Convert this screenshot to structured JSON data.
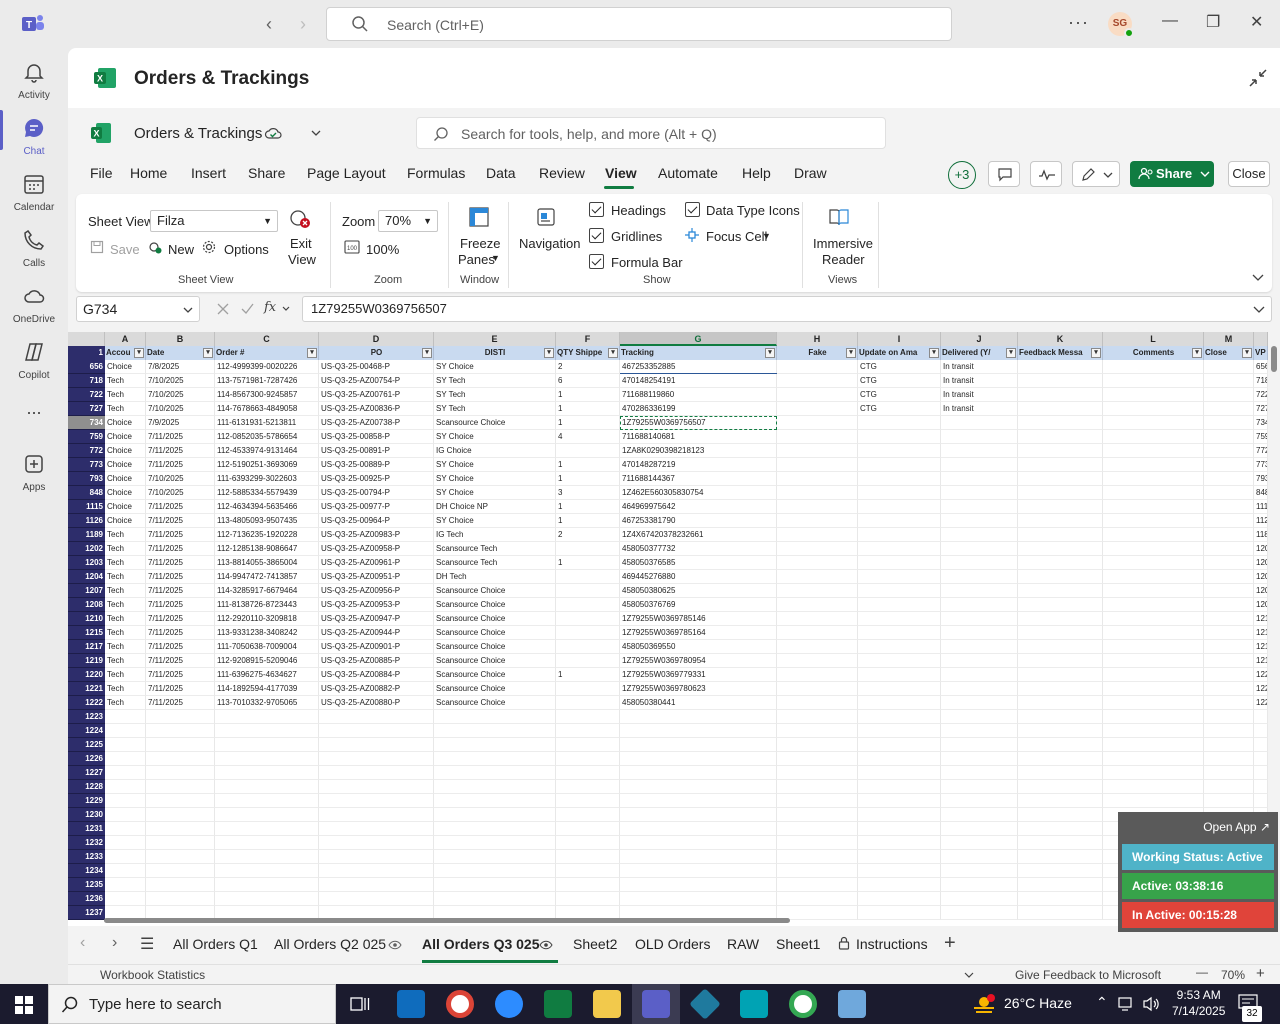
{
  "teams": {
    "search_placeholder": "Search (Ctrl+E)",
    "avatar_initials": "SG",
    "rail": [
      {
        "label": "Activity",
        "icon": "bell-icon"
      },
      {
        "label": "Chat",
        "icon": "chat-icon",
        "active": true
      },
      {
        "label": "Calendar",
        "icon": "calendar-icon"
      },
      {
        "label": "Calls",
        "icon": "phone-icon"
      },
      {
        "label": "OneDrive",
        "icon": "cloud-icon"
      },
      {
        "label": "Copilot",
        "icon": "copilot-icon"
      },
      {
        "label": "...",
        "icon": "more-icon"
      },
      {
        "label": "Apps",
        "icon": "apps-icon"
      }
    ],
    "app_title": "Orders & Trackings"
  },
  "excel": {
    "workbook_name": "Orders & Trackings",
    "tools_search_placeholder": "Search for tools, help, and more (Alt + Q)",
    "menu": [
      "File",
      "Home",
      "Insert",
      "Share",
      "Page Layout",
      "Formulas",
      "Data",
      "Review",
      "View",
      "Automate",
      "Help",
      "Draw"
    ],
    "active_menu": "View",
    "collab_count": "+3",
    "share_label": "Share",
    "close_label": "Close",
    "ribbon": {
      "sheet_view_label": "Sheet View",
      "sheet_view_value": "Filza",
      "save_label": "Save",
      "new_label": "New",
      "options_label": "Options",
      "exit_view_label_1": "Exit",
      "exit_view_label_2": "View",
      "group_sheet_view": "Sheet View",
      "zoom_label": "Zoom",
      "zoom_value": "70%",
      "zoom_100_label": "100%",
      "group_zoom": "Zoom",
      "freeze_label_1": "Freeze",
      "freeze_label_2": "Panes",
      "group_window": "Window",
      "navigation_label": "Navigation",
      "headings_label": "Headings",
      "gridlines_label": "Gridlines",
      "formula_bar_label": "Formula Bar",
      "data_type_icons_label": "Data Type Icons",
      "focus_cell_label": "Focus Cell",
      "group_show": "Show",
      "immersive_label_1": "Immersive",
      "immersive_label_2": "Reader",
      "group_views": "Views"
    },
    "name_box": "G734",
    "formula_value": "1Z79255W0369756507",
    "columns": [
      "A",
      "B",
      "C",
      "D",
      "E",
      "F",
      "G",
      "H",
      "I",
      "J",
      "K",
      "L",
      "M",
      ""
    ],
    "headers": [
      "Accou",
      "Date",
      "Order #",
      "PO",
      "DISTI",
      "QTY Shippe",
      "Tracking",
      "Fake",
      "Update on Ama",
      "Delivered (Y/",
      "Feedback Messa",
      "Comments",
      "Close",
      "VP"
    ],
    "row_numbers_top": "1",
    "rows": [
      {
        "n": "656",
        "a": "Choice",
        "b": "7/8/2025",
        "c": "112-4999399-0020226",
        "d": "US-Q3-25-00468-P",
        "e": "SY Choice",
        "f": "2",
        "g": "467253352885",
        "i": "CTG",
        "j": "In transit"
      },
      {
        "n": "718",
        "a": "Tech",
        "b": "7/10/2025",
        "c": "113-7571981-7287426",
        "d": "US-Q3-25-AZ00754-P",
        "e": "SY Tech",
        "f": "6",
        "g": "470148254191",
        "i": "CTG",
        "j": "In transit"
      },
      {
        "n": "722",
        "a": "Tech",
        "b": "7/10/2025",
        "c": "114-8567300-9245857",
        "d": "US-Q3-25-AZ00761-P",
        "e": "SY Tech",
        "f": "1",
        "g": "711688119860",
        "i": "CTG",
        "j": "In transit"
      },
      {
        "n": "727",
        "a": "Tech",
        "b": "7/10/2025",
        "c": "114-7678663-4849058",
        "d": "US-Q3-25-AZ00836-P",
        "e": "SY Tech",
        "f": "1",
        "g": "470286336199",
        "i": "CTG",
        "j": "In transit"
      },
      {
        "n": "734",
        "a": "Choice",
        "b": "7/9/2025",
        "c": "111-6131931-5213811",
        "d": "US-Q3-25-AZ00738-P",
        "e": "Scansource Choice",
        "f": "1",
        "g": "1Z79255W0369756507",
        "i": "",
        "j": ""
      },
      {
        "n": "759",
        "a": "Choice",
        "b": "7/11/2025",
        "c": "112-0852035-5786654",
        "d": "US-Q3-25-00858-P",
        "e": "SY Choice",
        "f": "4",
        "g": "711688140681",
        "i": "",
        "j": ""
      },
      {
        "n": "772",
        "a": "Choice",
        "b": "7/11/2025",
        "c": "112-4533974-9131464",
        "d": "US-Q3-25-00891-P",
        "e": "IG Choice",
        "f": "",
        "g": "1ZA8K0290398218123",
        "i": "",
        "j": ""
      },
      {
        "n": "773",
        "a": "Choice",
        "b": "7/11/2025",
        "c": "112-5190251-3693069",
        "d": "US-Q3-25-00889-P",
        "e": "SY Choice",
        "f": "1",
        "g": "470148287219",
        "i": "",
        "j": ""
      },
      {
        "n": "793",
        "a": "Choice",
        "b": "7/10/2025",
        "c": "111-6393299-3022603",
        "d": "US-Q3-25-00925-P",
        "e": "SY Choice",
        "f": "1",
        "g": "711688144367",
        "i": "",
        "j": ""
      },
      {
        "n": "848",
        "a": "Choice",
        "b": "7/10/2025",
        "c": "112-5885334-5579439",
        "d": "US-Q3-25-00794-P",
        "e": "SY Choice",
        "f": "3",
        "g": "1Z462E560305830754",
        "i": "",
        "j": ""
      },
      {
        "n": "1115",
        "a": "Choice",
        "b": "7/11/2025",
        "c": "112-4634394-5635466",
        "d": "US-Q3-25-00977-P",
        "e": "DH Choice NP",
        "f": "1",
        "g": "464969975642",
        "i": "",
        "j": ""
      },
      {
        "n": "1126",
        "a": "Choice",
        "b": "7/11/2025",
        "c": "113-4805093-9507435",
        "d": "US-Q3-25-00964-P",
        "e": "SY Choice",
        "f": "1",
        "g": "467253381790",
        "i": "",
        "j": ""
      },
      {
        "n": "1189",
        "a": "Tech",
        "b": "7/11/2025",
        "c": "112-7136235-1920228",
        "d": "US-Q3-25-AZ00983-P",
        "e": "IG Tech",
        "f": "2",
        "g": "1Z4X67420378232661",
        "i": "",
        "j": ""
      },
      {
        "n": "1202",
        "a": "Tech",
        "b": "7/11/2025",
        "c": "112-1285138-9086647",
        "d": "US-Q3-25-AZ00958-P",
        "e": "Scansource Tech",
        "f": "",
        "g": "458050377732",
        "i": "",
        "j": ""
      },
      {
        "n": "1203",
        "a": "Tech",
        "b": "7/11/2025",
        "c": "113-8814055-3865004",
        "d": "US-Q3-25-AZ00961-P",
        "e": "Scansource Tech",
        "f": "1",
        "g": "458050376585",
        "i": "",
        "j": ""
      },
      {
        "n": "1204",
        "a": "Tech",
        "b": "7/11/2025",
        "c": "114-9947472-7413857",
        "d": "US-Q3-25-AZ00951-P",
        "e": "DH Tech",
        "f": "",
        "g": "469445276880",
        "i": "",
        "j": ""
      },
      {
        "n": "1207",
        "a": "Tech",
        "b": "7/11/2025",
        "c": "114-3285917-6679464",
        "d": "US-Q3-25-AZ00956-P",
        "e": "Scansource Choice",
        "f": "",
        "g": "458050380625",
        "i": "",
        "j": ""
      },
      {
        "n": "1208",
        "a": "Tech",
        "b": "7/11/2025",
        "c": "111-8138726-8723443",
        "d": "US-Q3-25-AZ00953-P",
        "e": "Scansource Choice",
        "f": "",
        "g": "458050376769",
        "i": "",
        "j": ""
      },
      {
        "n": "1210",
        "a": "Tech",
        "b": "7/11/2025",
        "c": "112-2920110-3209818",
        "d": "US-Q3-25-AZ00947-P",
        "e": "Scansource Choice",
        "f": "",
        "g": "1Z79255W0369785146",
        "i": "",
        "j": ""
      },
      {
        "n": "1215",
        "a": "Tech",
        "b": "7/11/2025",
        "c": "113-9331238-3408242",
        "d": "US-Q3-25-AZ00944-P",
        "e": "Scansource Choice",
        "f": "",
        "g": "1Z79255W0369785164",
        "i": "",
        "j": ""
      },
      {
        "n": "1217",
        "a": "Tech",
        "b": "7/11/2025",
        "c": "111-7050638-7009004",
        "d": "US-Q3-25-AZ00901-P",
        "e": "Scansource Choice",
        "f": "",
        "g": "458050369550",
        "i": "",
        "j": ""
      },
      {
        "n": "1219",
        "a": "Tech",
        "b": "7/11/2025",
        "c": "112-9208915-5209046",
        "d": "US-Q3-25-AZ00885-P",
        "e": "Scansource Choice",
        "f": "",
        "g": "1Z79255W0369780954",
        "i": "",
        "j": ""
      },
      {
        "n": "1220",
        "a": "Tech",
        "b": "7/11/2025",
        "c": "111-6396275-4634627",
        "d": "US-Q3-25-AZ00884-P",
        "e": "Scansource Choice",
        "f": "1",
        "g": "1Z79255W0369779331",
        "i": "",
        "j": ""
      },
      {
        "n": "1221",
        "a": "Tech",
        "b": "7/11/2025",
        "c": "114-1892594-4177039",
        "d": "US-Q3-25-AZ00882-P",
        "e": "Scansource Choice",
        "f": "",
        "g": "1Z79255W0369780623",
        "i": "",
        "j": ""
      },
      {
        "n": "1222",
        "a": "Tech",
        "b": "7/11/2025",
        "c": "113-7010332-9705065",
        "d": "US-Q3-25-AZ00880-P",
        "e": "Scansource Choice",
        "f": "",
        "g": "458050380441",
        "i": "",
        "j": ""
      }
    ],
    "empty_rows": [
      "1223",
      "1224",
      "1225",
      "1226",
      "1227",
      "1228",
      "1229",
      "1230",
      "1231",
      "1232",
      "1233",
      "1234",
      "1235",
      "1236",
      "1237"
    ],
    "sheet_tabs": [
      {
        "label": "All Orders Q1"
      },
      {
        "label": "All Orders Q2 025",
        "eye": true
      },
      {
        "label": "All Orders Q3 025",
        "eye": true,
        "active": true
      },
      {
        "label": "Sheet2"
      },
      {
        "label": "OLD Orders"
      },
      {
        "label": "RAW"
      },
      {
        "label": "Sheet1"
      },
      {
        "label": "Instructions",
        "lock": true
      }
    ],
    "status": {
      "workbook_statistics": "Workbook Statistics",
      "feedback": "Give Feedback to Microsoft",
      "zoom": "70%"
    }
  },
  "widget": {
    "open_app": "Open App",
    "working_status": "Working Status: Active",
    "active_time": "Active: 03:38:16",
    "inactive_time": "In Active: 00:15:28",
    "colors": {
      "status": "#4fb3c8",
      "active": "#37a34a",
      "inactive": "#e0443a"
    }
  },
  "taskbar": {
    "search_placeholder": "Type here to search",
    "weather": "26°C  Haze",
    "time": "9:53 AM",
    "date": "7/14/2025",
    "notifications": "32"
  },
  "colors": {
    "excel_green": "#107c41",
    "teams_purple": "#5b5fc7",
    "header_blue": "#c9daf0",
    "rownum_navy": "#2d2d6b"
  }
}
